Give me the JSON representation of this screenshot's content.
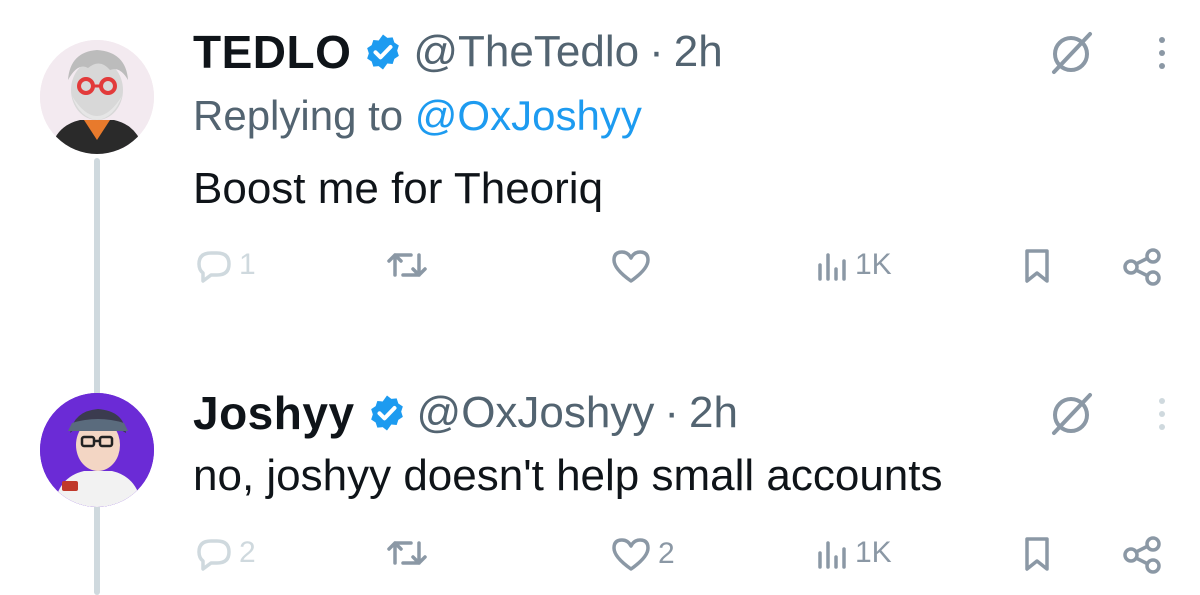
{
  "tweets": [
    {
      "display_name": "TEDLO",
      "handle": "@TheTedlo",
      "separator": "·",
      "time": "2h",
      "replying_prefix": "Replying to",
      "replying_to": "@OxJoshyy",
      "text": "Boost me for Theoriq",
      "reply_count": "1",
      "retweet_count": "",
      "like_count": "",
      "views": "1K"
    },
    {
      "display_name": "Joshyy",
      "handle": "@OxJoshyy",
      "separator": "·",
      "time": "2h",
      "text": "no, joshyy doesn't help small accounts",
      "reply_count": "2",
      "retweet_count": "",
      "like_count": "2",
      "views": "1K"
    }
  ],
  "icons": {
    "verified": "verified-badge-icon",
    "grok": "grok-icon",
    "more": "more-vertical-icon",
    "reply": "reply-icon",
    "retweet": "retweet-icon",
    "like": "heart-icon",
    "views": "views-icon",
    "bookmark": "bookmark-icon",
    "share": "share-icon"
  },
  "colors": {
    "verified_blue": "#1d9bf0",
    "mention_blue": "#1d9bf0",
    "secondary_text": "#536471",
    "action_gray": "#8b98a5",
    "thread_line": "#cfd9de"
  }
}
